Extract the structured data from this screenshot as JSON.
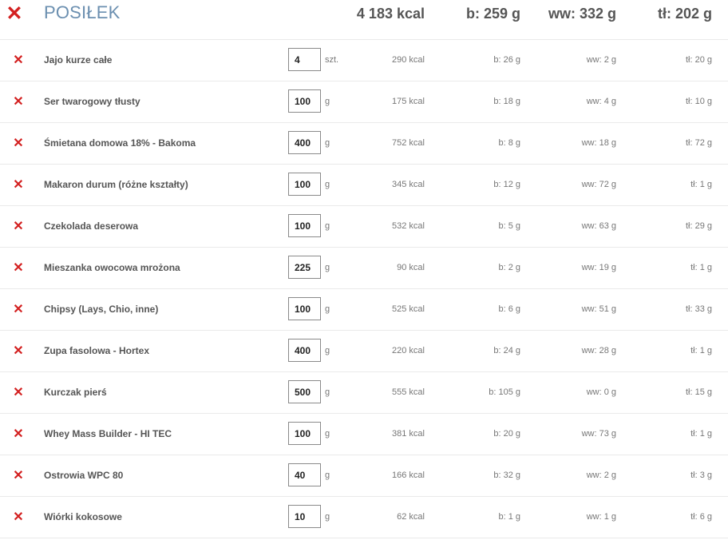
{
  "header": {
    "remove_all_icon": "close-icon",
    "title": "POSIŁEK",
    "total_kcal": "4 183 kcal",
    "total_b": "b: 259 g",
    "total_ww": "ww: 332 g",
    "total_tl": "tł: 202 g"
  },
  "colors": {
    "accent_title": "#6b8fb0",
    "delete_red": "#d32020",
    "text": "#555555",
    "muted": "#777777"
  },
  "items": [
    {
      "name": "Jajo kurze całe",
      "qty": "4",
      "unit": "szt.",
      "kcal": "290 kcal",
      "b": "b: 26 g",
      "ww": "ww: 2 g",
      "tl": "tł: 20 g"
    },
    {
      "name": "Ser twarogowy tłusty",
      "qty": "100",
      "unit": "g",
      "kcal": "175 kcal",
      "b": "b: 18 g",
      "ww": "ww: 4 g",
      "tl": "tł: 10 g"
    },
    {
      "name": "Śmietana domowa 18% - Bakoma",
      "qty": "400",
      "unit": "g",
      "kcal": "752 kcal",
      "b": "b: 8 g",
      "ww": "ww: 18 g",
      "tl": "tł: 72 g"
    },
    {
      "name": "Makaron durum (różne kształty)",
      "qty": "100",
      "unit": "g",
      "kcal": "345 kcal",
      "b": "b: 12 g",
      "ww": "ww: 72 g",
      "tl": "tł: 1 g"
    },
    {
      "name": "Czekolada deserowa",
      "qty": "100",
      "unit": "g",
      "kcal": "532 kcal",
      "b": "b: 5 g",
      "ww": "ww: 63 g",
      "tl": "tł: 29 g"
    },
    {
      "name": "Mieszanka owocowa mrożona",
      "qty": "225",
      "unit": "g",
      "kcal": "90 kcal",
      "b": "b: 2 g",
      "ww": "ww: 19 g",
      "tl": "tł: 1 g"
    },
    {
      "name": "Chipsy (Lays, Chio, inne)",
      "qty": "100",
      "unit": "g",
      "kcal": "525 kcal",
      "b": "b: 6 g",
      "ww": "ww: 51 g",
      "tl": "tł: 33 g"
    },
    {
      "name": "Zupa fasolowa - Hortex",
      "qty": "400",
      "unit": "g",
      "kcal": "220 kcal",
      "b": "b: 24 g",
      "ww": "ww: 28 g",
      "tl": "tł: 1 g"
    },
    {
      "name": "Kurczak pierś",
      "qty": "500",
      "unit": "g",
      "kcal": "555 kcal",
      "b": "b: 105 g",
      "ww": "ww: 0 g",
      "tl": "tł: 15 g"
    },
    {
      "name": "Whey Mass Builder - HI TEC",
      "qty": "100",
      "unit": "g",
      "kcal": "381 kcal",
      "b": "b: 20 g",
      "ww": "ww: 73 g",
      "tl": "tł: 1 g"
    },
    {
      "name": "Ostrowia WPC 80",
      "qty": "40",
      "unit": "g",
      "kcal": "166 kcal",
      "b": "b: 32 g",
      "ww": "ww: 2 g",
      "tl": "tł: 3 g"
    },
    {
      "name": "Wiórki kokosowe",
      "qty": "10",
      "unit": "g",
      "kcal": "62 kcal",
      "b": "b: 1 g",
      "ww": "ww: 1 g",
      "tl": "tł: 6 g"
    }
  ]
}
